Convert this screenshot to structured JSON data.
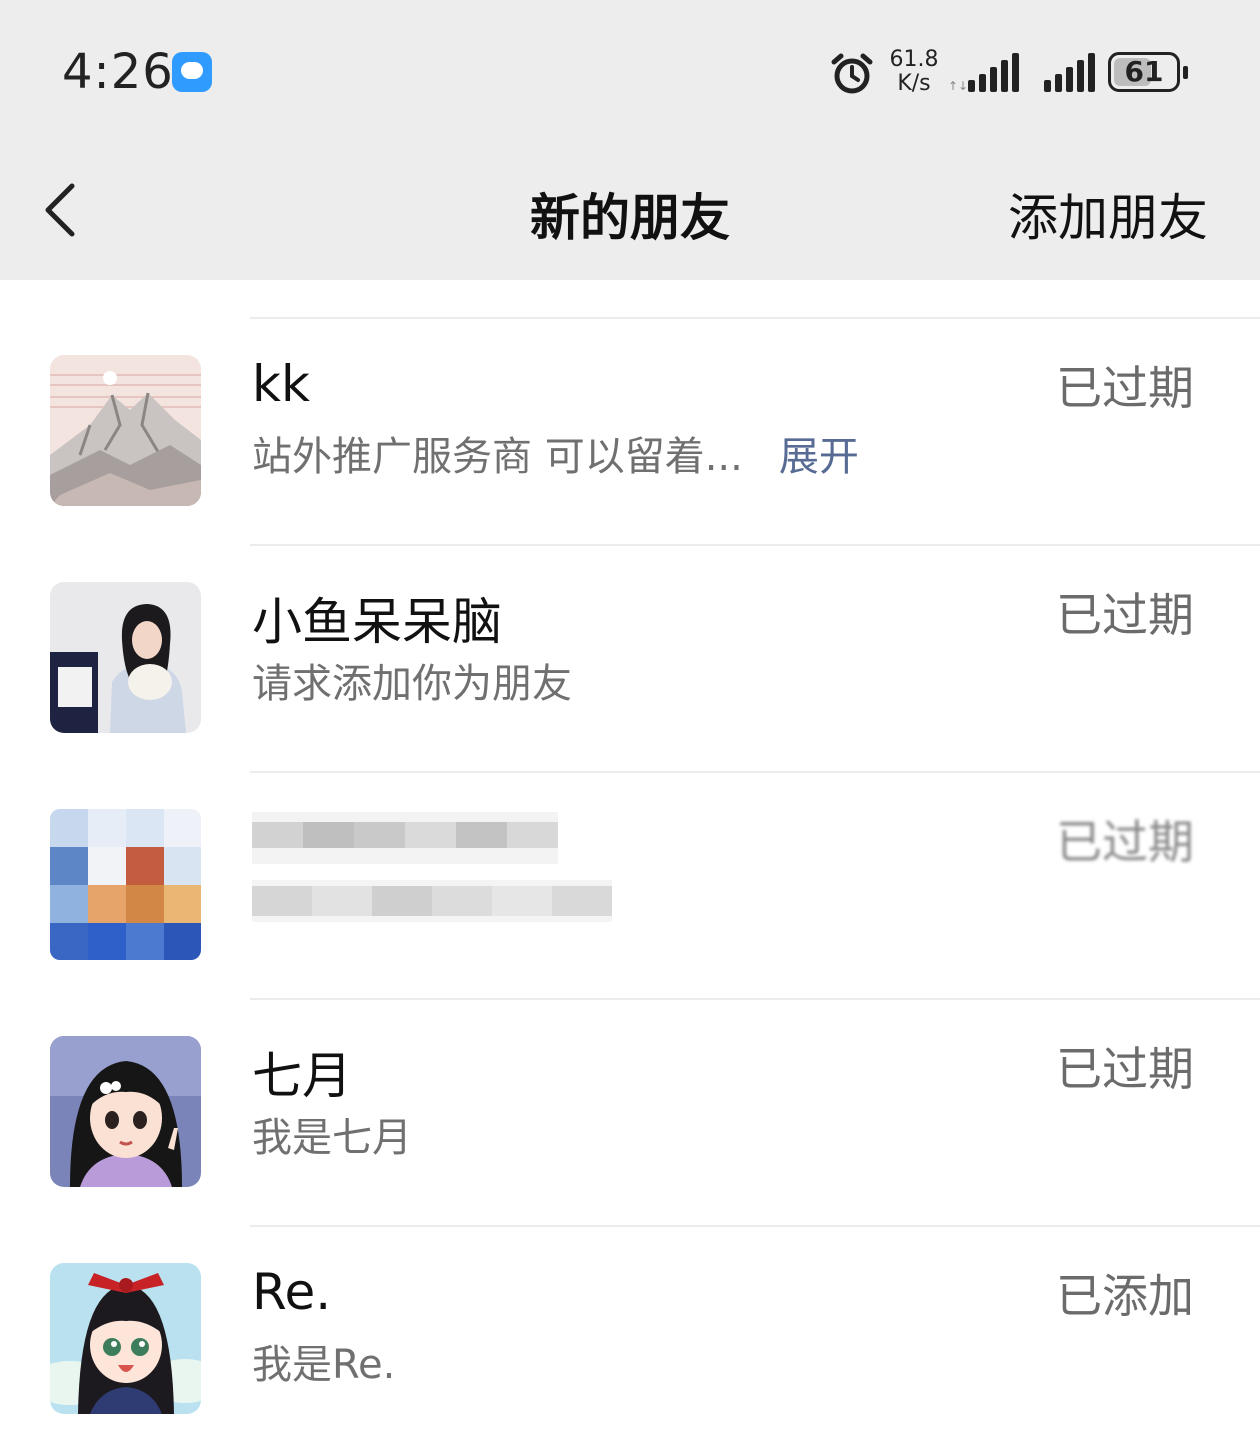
{
  "status_bar": {
    "time": "4:26",
    "net_speed_value": "61.8",
    "net_speed_unit": "K/s",
    "battery_level": 61
  },
  "nav": {
    "title": "新的朋友",
    "action": "添加朋友"
  },
  "requests": [
    {
      "name": "kk",
      "message": "站外推广服务商 可以留着...",
      "expand_label": "展开",
      "status": "已过期",
      "avatar": "mountain-landscape"
    },
    {
      "name": "小鱼呆呆脑",
      "message": "请求添加你为朋友",
      "status": "已过期",
      "avatar": "girl-photo"
    },
    {
      "name": "",
      "message": "",
      "status": "已过期",
      "avatar": "pixelated",
      "redacted": true
    },
    {
      "name": "七月",
      "message": "我是七月",
      "status": "已过期",
      "avatar": "cartoon-girl"
    },
    {
      "name": "Re.",
      "message": "我是Re.",
      "status": "已添加",
      "avatar": "cartoon-girl-red-bow"
    }
  ]
}
